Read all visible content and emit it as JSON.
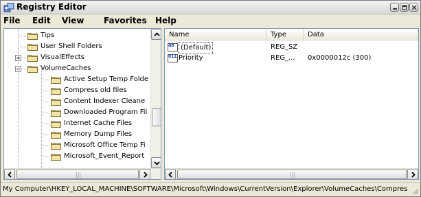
{
  "window": {
    "title": "Registry Editor"
  },
  "menu": [
    "File",
    "Edit",
    "View",
    "Favorites",
    "Help"
  ],
  "tree": {
    "items": [
      {
        "label": "Tips",
        "expander": ""
      },
      {
        "label": "User Shell Folders",
        "expander": ""
      },
      {
        "label": "VisualEffects",
        "expander": "+"
      },
      {
        "label": "VolumeCaches",
        "expander": "-"
      },
      {
        "label": "Active Setup Temp Folde",
        "expander": ""
      },
      {
        "label": "Compress old files",
        "expander": ""
      },
      {
        "label": "Content Indexer Cleane",
        "expander": ""
      },
      {
        "label": "Downloaded Program Fil",
        "expander": ""
      },
      {
        "label": "Internet Cache Files",
        "expander": ""
      },
      {
        "label": "Memory Dump Files",
        "expander": ""
      },
      {
        "label": "Microsoft Office Temp Fi",
        "expander": ""
      },
      {
        "label": "Microsoft_Event_Report",
        "expander": ""
      }
    ]
  },
  "list": {
    "columns": [
      "Name",
      "Type",
      "Data"
    ],
    "rows": [
      {
        "icon": "ab",
        "name": "(Default)",
        "type": "REG_SZ",
        "data": ""
      },
      {
        "icon": "011",
        "name": "Priority",
        "type": "REG_...",
        "data": "0x0000012c (300)"
      }
    ]
  },
  "status": {
    "path": "My Computer\\HKEY_LOCAL_MACHINE\\SOFTWARE\\Microsoft\\Windows\\CurrentVersion\\Explorer\\VolumeCaches\\Compres"
  },
  "icons": {
    "app": "registry-editor-icon",
    "folder": "folder-icon",
    "string_value": "string-value-icon",
    "binary_value": "dword-value-icon"
  },
  "colors": {
    "folder": "#f2e4a8",
    "folder_outline": "#7a6a2a",
    "pane_border": "#7f9db9"
  }
}
